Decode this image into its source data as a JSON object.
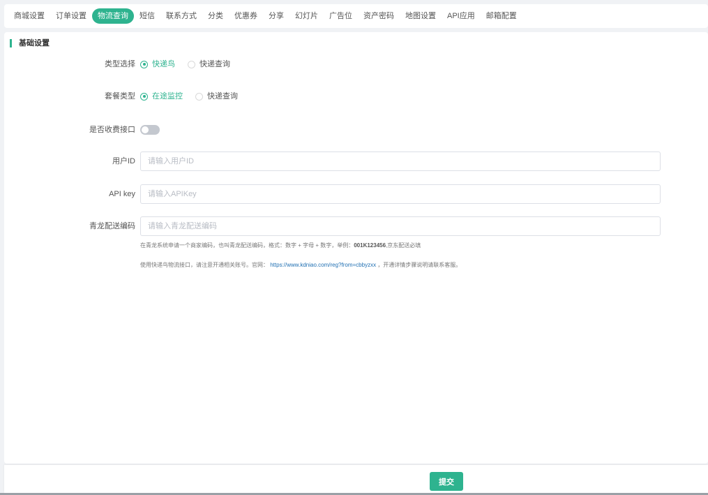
{
  "tabs": [
    {
      "label": "商城设置",
      "active": false
    },
    {
      "label": "订单设置",
      "active": false
    },
    {
      "label": "物流查询",
      "active": true
    },
    {
      "label": "短信",
      "active": false
    },
    {
      "label": "联系方式",
      "active": false
    },
    {
      "label": "分类",
      "active": false
    },
    {
      "label": "优惠券",
      "active": false
    },
    {
      "label": "分享",
      "active": false
    },
    {
      "label": "幻灯片",
      "active": false
    },
    {
      "label": "广告位",
      "active": false
    },
    {
      "label": "资产密码",
      "active": false
    },
    {
      "label": "地图设置",
      "active": false
    },
    {
      "label": "API应用",
      "active": false
    },
    {
      "label": "邮箱配置",
      "active": false
    }
  ],
  "section_title": "基础设置",
  "form": {
    "type_select": {
      "label": "类型选择",
      "options": [
        {
          "label": "快递鸟",
          "checked": true
        },
        {
          "label": "快递查询",
          "checked": false
        }
      ]
    },
    "package_type": {
      "label": "套餐类型",
      "options": [
        {
          "label": "在途监控",
          "checked": true
        },
        {
          "label": "快递查询",
          "checked": false
        }
      ]
    },
    "charge_api": {
      "label": "是否收费接口",
      "on": false
    },
    "user_id": {
      "label": "用户ID",
      "value": "",
      "placeholder": "请输入用户ID"
    },
    "api_key": {
      "label": "API key",
      "value": "",
      "placeholder": "请输入APIKey"
    },
    "qinglong_code": {
      "label": "青龙配送编码",
      "value": "",
      "placeholder": "请输入青龙配送编码"
    }
  },
  "help": {
    "line1_text": "在青龙系统申请一个商家编码，也叫青龙配送编码，格式：数字 + 字母 + 数字，举例：",
    "line1_example": "001K123456",
    "line1_suffix": ",京东配送必填",
    "line2_prefix": "使用快递鸟物流接口，请注意开通相关账号。官网：",
    "line2_link": "https://www.kdniao.com/reg?from=cbbyzxx",
    "line2_suffix": "，开通详情步骤说明请联系客服。"
  },
  "footer": {
    "submit_label": "提交"
  },
  "colors": {
    "accent": "#2eb38f",
    "link": "#1f6fb2",
    "background": "#f0f2f5"
  }
}
